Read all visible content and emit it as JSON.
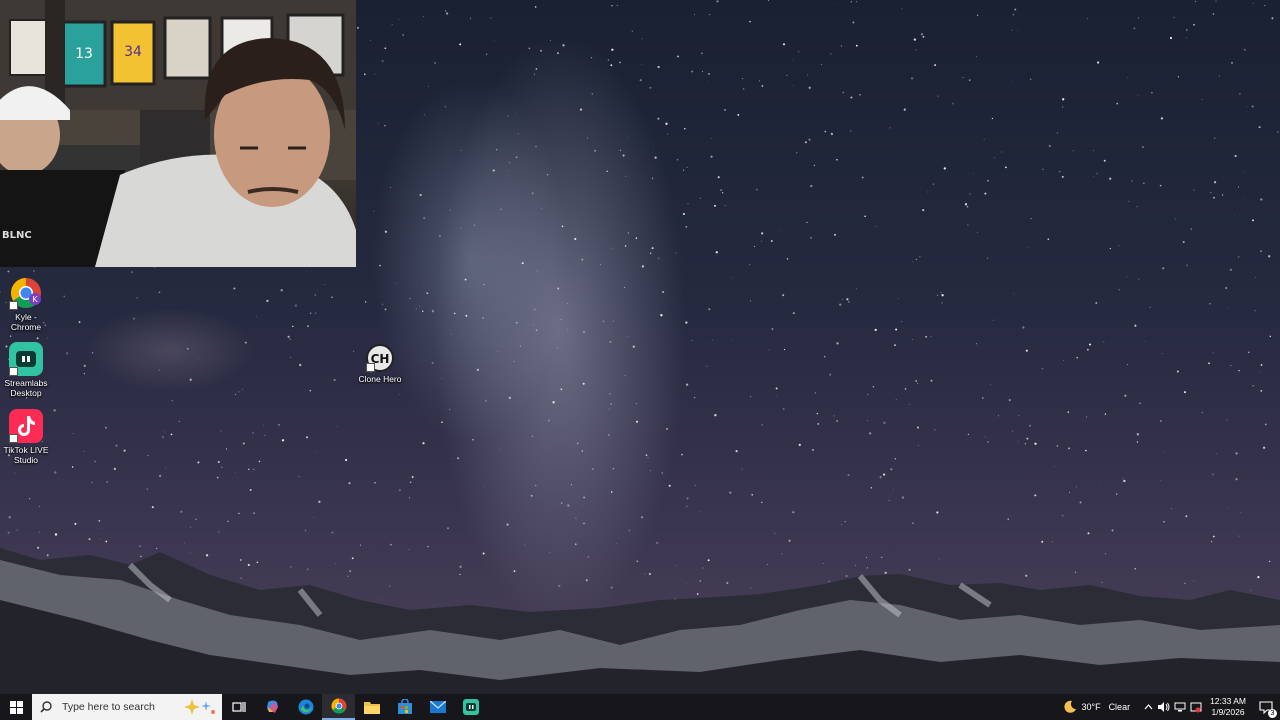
{
  "desktop": {
    "icons": [
      {
        "label": "Kyle - Chrome",
        "icon": "chrome-profile-icon",
        "badge": "K"
      },
      {
        "label": "Streamlabs Desktop",
        "icon": "streamlabs-icon"
      },
      {
        "label": "TikTok LIVE Studio",
        "icon": "tiktok-live-icon"
      },
      {
        "label": "Clone Hero",
        "icon": "clone-hero-icon",
        "badge": "CH"
      }
    ]
  },
  "webcam": {
    "shirt_text": "BLNC",
    "jersey_number": "13",
    "jersey_number_2": "34"
  },
  "taskbar": {
    "search_placeholder": "Type here to search",
    "weather": {
      "temp": "30°F",
      "condition": "Clear"
    },
    "clock": {
      "time": "12:33 AM",
      "date": "1/9/2026"
    },
    "notification_count": "3"
  },
  "colors": {
    "taskbar": "#17161b",
    "streamlabs": "#31c3a2",
    "tiktok": "#fe2c55"
  }
}
